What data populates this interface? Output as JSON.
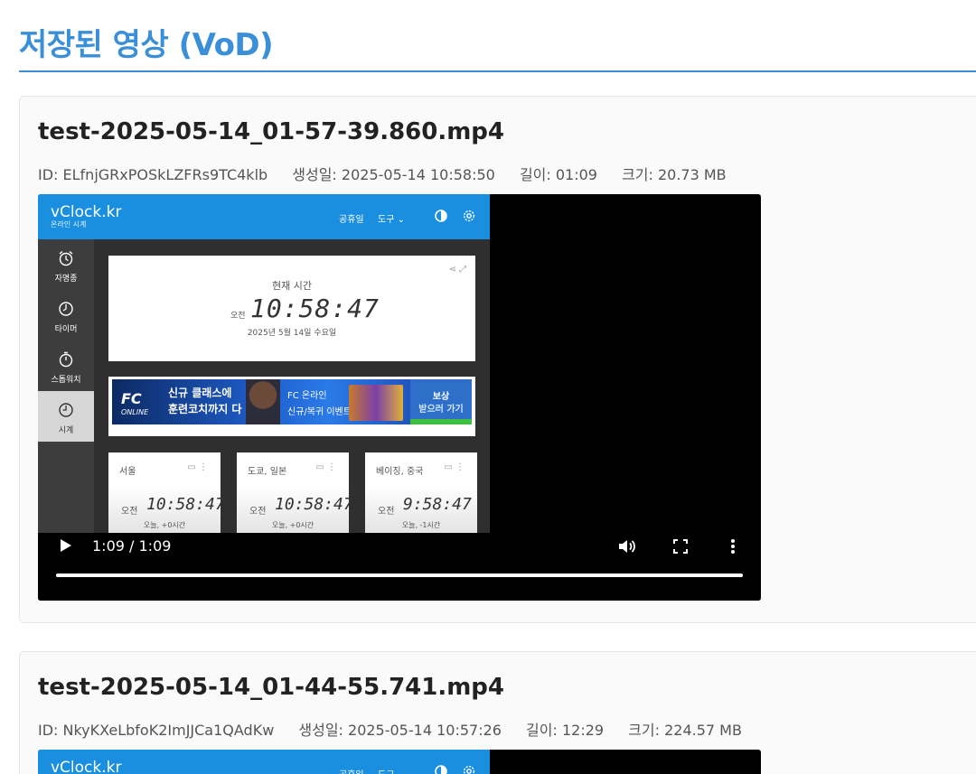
{
  "page": {
    "title": "저장된 영상 (VoD)"
  },
  "videos": [
    {
      "filename": "test-2025-05-14_01-57-39.860.mp4",
      "id": "ID: ELfnjGRxPOSkLZFRs9TC4klb",
      "created": "생성일: 2025-05-14 10:58:50",
      "duration": "길이: 01:09",
      "size": "크기: 20.73 MB",
      "player": {
        "time_display": "1:09 / 1:09",
        "progress": 1.0
      },
      "frame": {
        "logo": "vClock.kr",
        "logo_sub": "온라인 시계",
        "nav": [
          "공휴일",
          "도구 ⌄"
        ],
        "side_items": [
          "자명종",
          "타이머",
          "스톱워치",
          "시계"
        ],
        "clock_caption": "현재 시간",
        "clock_ampm": "오전",
        "clock_time": "10:58:47",
        "clock_date": "2025년 5월 14일 수요일",
        "ad": {
          "brand": "FC",
          "brand_sub": "ONLINE",
          "line1": "신규 클래스에",
          "line2": "훈련코치까지 다 줘?",
          "line3": "FC 온라인",
          "line4": "신규/복귀 이벤트",
          "cta1": "보상",
          "cta2": "받으러 가기"
        },
        "cities": [
          {
            "name": "서울",
            "ampm": "오전",
            "time": "10:58:47",
            "diff": "오늘, +0시간"
          },
          {
            "name": "도쿄, 일본",
            "ampm": "오전",
            "time": "10:58:47",
            "diff": "오늘, +0시간"
          },
          {
            "name": "베이징, 중국",
            "ampm": "오전",
            "time": "9:58:47",
            "diff": "오늘, -1시간"
          }
        ]
      }
    },
    {
      "filename": "test-2025-05-14_01-44-55.741.mp4",
      "id": "ID: NkyKXeLbfoK2ImJJCa1QAdKw",
      "created": "생성일: 2025-05-14 10:57:26",
      "duration": "길이: 12:29",
      "size": "크기: 224.57 MB",
      "frame": {
        "logo": "vClock.kr",
        "nav": [
          "공휴일",
          "도구 ⌄"
        ]
      }
    }
  ]
}
